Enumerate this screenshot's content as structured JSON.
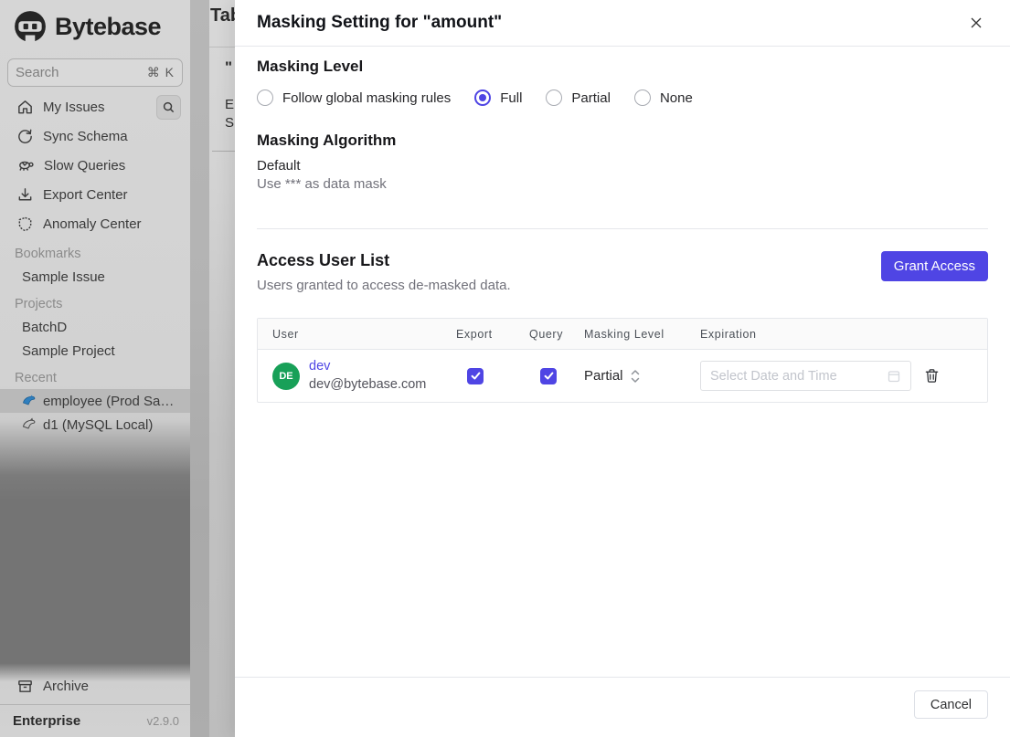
{
  "colors": {
    "accent": "#4f45e4",
    "avatar_green": "#18a058",
    "link_blue": "#4f46e5"
  },
  "sidebar": {
    "logo_text": "Bytebase",
    "search": {
      "placeholder": "Search",
      "shortcut": "⌘ K"
    },
    "nav": [
      {
        "label": "My Issues",
        "icon": "home-icon"
      },
      {
        "label": "Sync Schema",
        "icon": "sync-icon"
      },
      {
        "label": "Slow Queries",
        "icon": "turtle-icon"
      },
      {
        "label": "Export Center",
        "icon": "download-icon"
      },
      {
        "label": "Anomaly Center",
        "icon": "shield-icon"
      }
    ],
    "sections": [
      {
        "header": "Bookmarks",
        "items": [
          {
            "label": "Sample Issue"
          }
        ]
      },
      {
        "header": "Projects",
        "items": [
          {
            "label": "BatchD"
          },
          {
            "label": "Sample Project"
          }
        ]
      },
      {
        "header": "Recent",
        "items": [
          {
            "label": "employee (Prod Sam...",
            "selected": true
          },
          {
            "label": "d1 (MySQL Local)",
            "selected": false
          }
        ]
      }
    ],
    "archive_label": "Archive",
    "plan": "Enterprise",
    "version": "v2.9.0"
  },
  "background_page": {
    "title_fragment": "Tab",
    "quote_fragment": "\"",
    "fragment_e": "E",
    "fragment_s": "S"
  },
  "modal": {
    "title": "Masking Setting for \"amount\"",
    "masking_level": {
      "heading": "Masking Level",
      "options": [
        {
          "label": "Follow global masking rules",
          "selected": false
        },
        {
          "label": "Full",
          "selected": true
        },
        {
          "label": "Partial",
          "selected": false
        },
        {
          "label": "None",
          "selected": false
        }
      ]
    },
    "masking_algorithm": {
      "heading": "Masking Algorithm",
      "name": "Default",
      "description": "Use *** as data mask"
    },
    "access": {
      "heading": "Access User List",
      "subtitle": "Users granted to access de-masked data.",
      "grant_button": "Grant Access",
      "table": {
        "columns": {
          "user": "User",
          "export": "Export",
          "query": "Query",
          "masking_level": "Masking Level",
          "expiration": "Expiration"
        },
        "rows": [
          {
            "avatar_initials": "DE",
            "name": "dev",
            "email": "dev@bytebase.com",
            "export_checked": true,
            "query_checked": true,
            "masking_level": "Partial",
            "expiration_placeholder": "Select Date and Time"
          }
        ]
      }
    },
    "footer": {
      "cancel_label": "Cancel"
    }
  }
}
